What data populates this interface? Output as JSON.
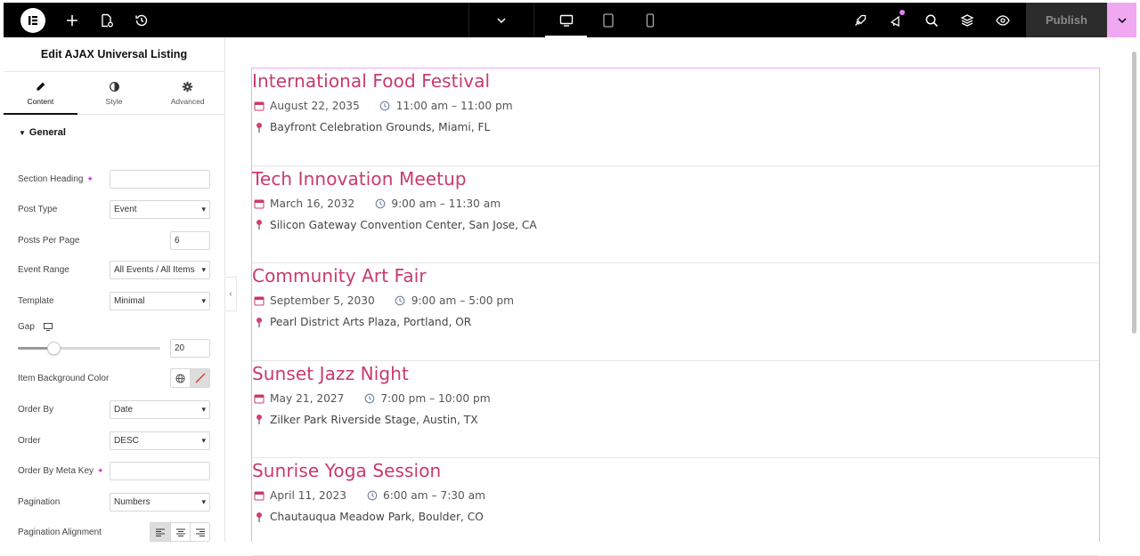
{
  "topbar": {
    "logo_icon": "elementor-logo-icon",
    "left_icons": [
      "plus-icon",
      "page-settings-icon",
      "history-icon"
    ],
    "devices": [
      "desktop-icon",
      "tablet-icon",
      "mobile-icon"
    ],
    "right_icons": [
      "rocket-icon",
      "notifications-icon",
      "search-icon",
      "layers-icon",
      "preview-eye-icon"
    ],
    "publish_label": "Publish"
  },
  "panel": {
    "title": "Edit AJAX Universal Listing",
    "tabs": [
      {
        "label": "Content",
        "icon": "pencil-icon",
        "active": true
      },
      {
        "label": "Style",
        "icon": "half-circle-icon",
        "active": false
      },
      {
        "label": "Advanced",
        "icon": "gear-icon",
        "active": false
      }
    ],
    "section": "General",
    "controls": {
      "section_heading": {
        "label": "Section Heading",
        "value": ""
      },
      "post_type": {
        "label": "Post Type",
        "value": "Event"
      },
      "posts_per_page": {
        "label": "Posts Per Page",
        "value": "6"
      },
      "event_range": {
        "label": "Event Range",
        "value": "All Events / All Items"
      },
      "template": {
        "label": "Template",
        "value": "Minimal"
      },
      "gap": {
        "label": "Gap",
        "value": "20",
        "slider_fraction": 0.25
      },
      "item_bg": {
        "label": "Item Background Color"
      },
      "order_by": {
        "label": "Order By",
        "value": "Date"
      },
      "order": {
        "label": "Order",
        "value": "DESC"
      },
      "order_by_meta": {
        "label": "Order By Meta Key",
        "value": ""
      },
      "pagination": {
        "label": "Pagination",
        "value": "Numbers"
      },
      "pagination_alignment": {
        "label": "Pagination Alignment",
        "active": "left"
      }
    }
  },
  "events": [
    {
      "title": "International Food Festival",
      "date": "August 22, 2035",
      "time": "11:00 am – 11:00 pm",
      "location": "Bayfront Celebration Grounds, Miami, FL"
    },
    {
      "title": "Tech Innovation Meetup",
      "date": "March 16, 2032",
      "time": "9:00 am – 11:30 am",
      "location": "Silicon Gateway Convention Center, San Jose, CA"
    },
    {
      "title": "Community Art Fair",
      "date": "September 5, 2030",
      "time": "9:00 am – 5:00 pm",
      "location": "Pearl District Arts Plaza, Portland, OR"
    },
    {
      "title": "Sunset Jazz Night",
      "date": "May 21, 2027",
      "time": "7:00 pm – 10:00 pm",
      "location": "Zilker Park Riverside Stage, Austin, TX"
    },
    {
      "title": "Sunrise Yoga Session",
      "date": "April 11, 2023",
      "time": "6:00 am – 7:30 am",
      "location": "Chautauqua Meadow Park, Boulder, CO"
    }
  ],
  "colors": {
    "accent": "#c83a6c",
    "publish_drop": "#f0a8f0",
    "selection_border": "#f0a8f0"
  }
}
